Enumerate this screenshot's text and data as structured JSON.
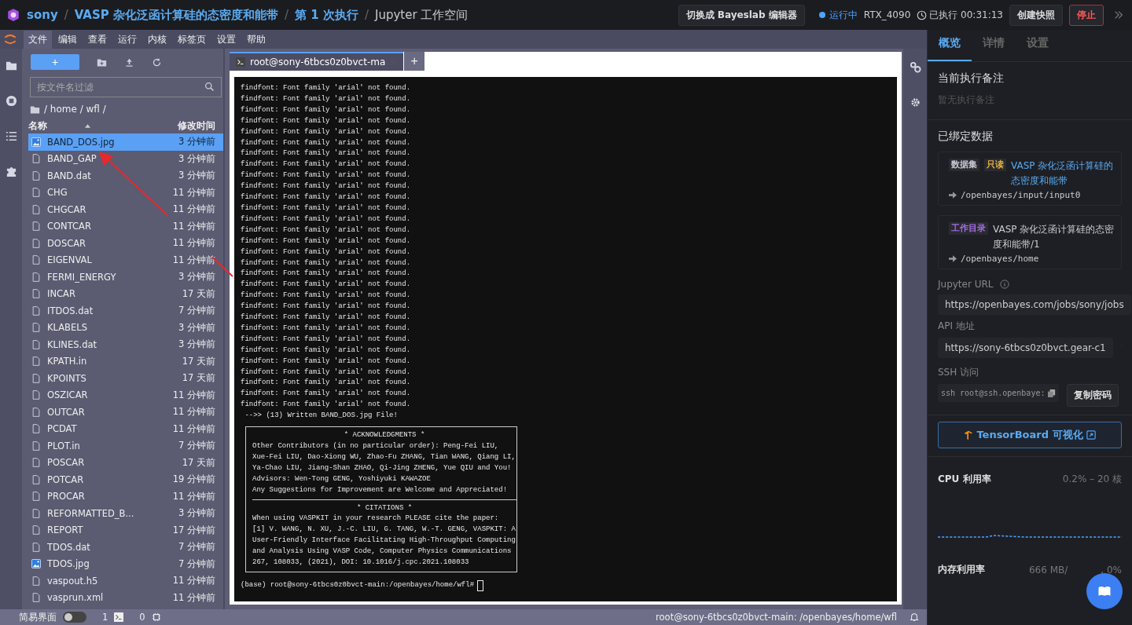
{
  "top_bar": {
    "breadcrumb": [
      {
        "text": "sony",
        "kind": "link"
      },
      {
        "text": "VASP 杂化泛函计算硅的态密度和能带",
        "kind": "link"
      },
      {
        "text": "第 1 次执行",
        "kind": "link"
      },
      {
        "text": "Jupyter 工作空间",
        "kind": "current"
      }
    ],
    "separator": "/",
    "switch_button": "切换成 Bayeslab 编辑器",
    "status": "运行中",
    "gpu": "RTX_4090",
    "elapsed": "已执行 00:31:13",
    "snapshot_button": "创建快照",
    "stop_button": "停止"
  },
  "menu": [
    {
      "label": "文件",
      "selected": true
    },
    {
      "label": "编辑",
      "selected": false
    },
    {
      "label": "查看",
      "selected": false
    },
    {
      "label": "运行",
      "selected": false
    },
    {
      "label": "内核",
      "selected": false
    },
    {
      "label": "标签页",
      "selected": false
    },
    {
      "label": "设置",
      "selected": false
    },
    {
      "label": "帮助",
      "selected": false
    }
  ],
  "file_browser": {
    "new_button": "+",
    "filter": {
      "placeholder": "按文件名过滤"
    },
    "path": "/ home / wfl /",
    "columns": [
      "名称",
      "修改时间"
    ],
    "files": [
      {
        "name": "BAND_DOS.jpg",
        "time": "3 分钟前",
        "kind": "image",
        "selected": true
      },
      {
        "name": "BAND_GAP",
        "time": "3 分钟前",
        "kind": "file",
        "selected": false
      },
      {
        "name": "BAND.dat",
        "time": "3 分钟前",
        "kind": "file",
        "selected": false
      },
      {
        "name": "CHG",
        "time": "11 分钟前",
        "kind": "file",
        "selected": false
      },
      {
        "name": "CHGCAR",
        "time": "11 分钟前",
        "kind": "file",
        "selected": false
      },
      {
        "name": "CONTCAR",
        "time": "11 分钟前",
        "kind": "file",
        "selected": false
      },
      {
        "name": "DOSCAR",
        "time": "11 分钟前",
        "kind": "file",
        "selected": false
      },
      {
        "name": "EIGENVAL",
        "time": "11 分钟前",
        "kind": "file",
        "selected": false
      },
      {
        "name": "FERMI_ENERGY",
        "time": "3 分钟前",
        "kind": "file",
        "selected": false
      },
      {
        "name": "INCAR",
        "time": "17 天前",
        "kind": "file",
        "selected": false
      },
      {
        "name": "ITDOS.dat",
        "time": "7 分钟前",
        "kind": "file",
        "selected": false
      },
      {
        "name": "KLABELS",
        "time": "3 分钟前",
        "kind": "file",
        "selected": false
      },
      {
        "name": "KLINES.dat",
        "time": "3 分钟前",
        "kind": "file",
        "selected": false
      },
      {
        "name": "KPATH.in",
        "time": "17 天前",
        "kind": "file",
        "selected": false
      },
      {
        "name": "KPOINTS",
        "time": "17 天前",
        "kind": "file",
        "selected": false
      },
      {
        "name": "OSZICAR",
        "time": "11 分钟前",
        "kind": "file",
        "selected": false
      },
      {
        "name": "OUTCAR",
        "time": "11 分钟前",
        "kind": "file",
        "selected": false
      },
      {
        "name": "PCDAT",
        "time": "11 分钟前",
        "kind": "file",
        "selected": false
      },
      {
        "name": "PLOT.in",
        "time": "7 分钟前",
        "kind": "file",
        "selected": false
      },
      {
        "name": "POSCAR",
        "time": "17 天前",
        "kind": "file",
        "selected": false
      },
      {
        "name": "POTCAR",
        "time": "19 分钟前",
        "kind": "file",
        "selected": false
      },
      {
        "name": "PROCAR",
        "time": "11 分钟前",
        "kind": "file",
        "selected": false
      },
      {
        "name": "REFORMATTED_B...",
        "time": "3 分钟前",
        "kind": "file",
        "selected": false
      },
      {
        "name": "REPORT",
        "time": "17 分钟前",
        "kind": "file",
        "selected": false
      },
      {
        "name": "TDOS.dat",
        "time": "7 分钟前",
        "kind": "file",
        "selected": false
      },
      {
        "name": "TDOS.jpg",
        "time": "7 分钟前",
        "kind": "image",
        "selected": false
      },
      {
        "name": "vaspout.h5",
        "time": "11 分钟前",
        "kind": "file",
        "selected": false
      },
      {
        "name": "vasprun.xml",
        "time": "11 分钟前",
        "kind": "file",
        "selected": false
      }
    ]
  },
  "terminal": {
    "tab": {
      "label": "root@sony-6tbcs0z0bvct-ma",
      "selected": true
    },
    "add_tab": "+",
    "lines": [
      "findfont: Font family 'arial' not found.",
      "findfont: Font family 'arial' not found.",
      "findfont: Font family 'arial' not found.",
      "findfont: Font family 'arial' not found.",
      "findfont: Font family 'arial' not found.",
      "findfont: Font family 'arial' not found.",
      "findfont: Font family 'arial' not found.",
      "findfont: Font family 'arial' not found.",
      "findfont: Font family 'arial' not found.",
      "findfont: Font family 'arial' not found.",
      "findfont: Font family 'arial' not found.",
      "findfont: Font family 'arial' not found.",
      "findfont: Font family 'arial' not found.",
      "findfont: Font family 'arial' not found.",
      "findfont: Font family 'arial' not found.",
      "findfont: Font family 'arial' not found.",
      "findfont: Font family 'arial' not found.",
      "findfont: Font family 'arial' not found.",
      "findfont: Font family 'arial' not found.",
      "findfont: Font family 'arial' not found.",
      "findfont: Font family 'arial' not found.",
      "findfont: Font family 'arial' not found.",
      "findfont: Font family 'arial' not found.",
      "findfont: Font family 'arial' not found.",
      "findfont: Font family 'arial' not found.",
      "findfont: Font family 'arial' not found.",
      "findfont: Font family 'arial' not found.",
      "findfont: Font family 'arial' not found.",
      "findfont: Font family 'arial' not found.",
      "findfont: Font family 'arial' not found.",
      " -->> (13) Written BAND_DOS.jpg File!"
    ],
    "sections": [
      {
        "title": "* ACKNOWLEDGMENTS *",
        "lines": [
          "Other Contributors (in no particular order): Peng-Fei LIU,",
          "Xue-Fei LIU, Dao-Xiong WU, Zhao-Fu ZHANG, Tian WANG, Qiang LI,",
          "Ya-Chao LIU, Jiang-Shan ZHAO, Qi-Jing ZHENG, Yue QIU and You!",
          "Advisors: Wen-Tong GENG, Yoshiyuki KAWAZOE",
          "Any Suggestions for Improvement are Welcome and Appreciated!"
        ]
      },
      {
        "title": "* CITATIONS *",
        "lines": [
          "When using VASPKIT in your research PLEASE cite the paper:",
          "[1] V. WANG, N. XU, J.-C. LIU, G. TANG, W.-T. GENG, VASPKIT: A",
          "User-Friendly Interface Facilitating High-Throughput Computing",
          "and Analysis Using VASP Code, Computer Physics Communications",
          "267, 108033, (2021), DOI: 10.1016/j.cpc.2021.108033"
        ]
      }
    ],
    "prompt": "(base) root@sony-6tbcs0z0bvct-main:/openbayes/home/wfl#"
  },
  "status_bar": {
    "simple_mode": {
      "label": "简易界面",
      "on": false
    },
    "terminals": "1",
    "kernels": "0",
    "path": "root@sony-6tbcs0z0bvct-main: /openbayes/home/wfl"
  },
  "side_panel": {
    "tabs": [
      {
        "label": "概览",
        "selected": true
      },
      {
        "label": "详情",
        "selected": false
      },
      {
        "label": "设置",
        "selected": false
      }
    ],
    "note_title": "当前执行备注",
    "note_empty": "暂无执行备注",
    "bound_title": "已绑定数据",
    "bindings": [
      {
        "tags": [
          {
            "text": "数据集",
            "color": "#c8ccd6"
          },
          {
            "text": "只读",
            "color": "#e3b341"
          }
        ],
        "name": "VASP 杂化泛函计算硅的态密度和能带",
        "link": true,
        "path": "/openbayes/input/input0"
      },
      {
        "tags": [
          {
            "text": "工作目录",
            "color": "#a66ee8"
          }
        ],
        "name": "VASP 杂化泛函计算硅的态密度和能带/1",
        "link": false,
        "path": "/openbayes/home"
      }
    ],
    "jupyter_url": {
      "label": "Jupyter URL",
      "value": "https://openbayes.com/jobs/sony/jobs"
    },
    "api": {
      "label": "API 地址",
      "value": "https://sony-6tbcs0z0bvct.gear-c1"
    },
    "ssh": {
      "label": "SSH 访问",
      "value": "ssh root@ssh.openbaye:",
      "button": "复制密码"
    },
    "tensorboard": "TensorBoard 可视化",
    "cpu": {
      "label": "CPU 利用率",
      "reading": "0.2% – 20 核"
    },
    "memory": {
      "label": "内存利用率",
      "reading": "666 MB/",
      "reading_end": ", 0%"
    }
  }
}
